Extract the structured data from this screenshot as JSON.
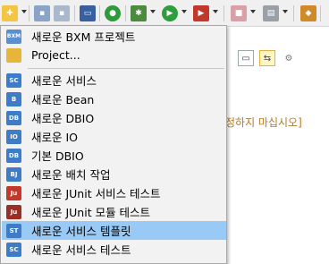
{
  "toolbar": {
    "icons": [
      "new-wizard-icon",
      "save-icon",
      "save-all-icon",
      "console-icon",
      "bxm-run-icon",
      "debug-icon",
      "run-icon",
      "external-tools-icon",
      "stop-icon",
      "open-perspective-icon",
      "package-icon"
    ]
  },
  "editor": {
    "hint_text": "정하지 마십시오]"
  },
  "menu": {
    "items": [
      {
        "label": "새로운 BXM 프로젝트",
        "icon": "bxm-project-icon",
        "icon_text": "BXM"
      },
      {
        "label": "Project...",
        "icon": "project-icon",
        "icon_text": ""
      },
      {
        "label": "새로운 서비스",
        "icon": "service-icon",
        "icon_text": "SC"
      },
      {
        "label": "새로운 Bean",
        "icon": "bean-icon",
        "icon_text": "B"
      },
      {
        "label": "새로운 DBIO",
        "icon": "dbio-icon",
        "icon_text": "DB"
      },
      {
        "label": "새로운 IO",
        "icon": "io-icon",
        "icon_text": "IO"
      },
      {
        "label": "기본 DBIO",
        "icon": "default-dbio-icon",
        "icon_text": "DB"
      },
      {
        "label": "새로운 배치 작업",
        "icon": "batch-job-icon",
        "icon_text": "BJ"
      },
      {
        "label": "새로운 JUnit 서비스 테스트",
        "icon": "junit-service-test-icon",
        "icon_text": "Ju"
      },
      {
        "label": "새로운 JUnit 모듈 테스트",
        "icon": "junit-module-test-icon",
        "icon_text": "Ju"
      },
      {
        "label": "새로운 서비스 템플릿",
        "icon": "service-template-icon",
        "icon_text": "ST"
      },
      {
        "label": "새로운 서비스 테스트",
        "icon": "service-test-icon",
        "icon_text": "SC"
      }
    ]
  },
  "colors": {
    "highlight": "#99c9f5",
    "menu_bg": "#f2f2f2",
    "hint": "#b07a30"
  }
}
